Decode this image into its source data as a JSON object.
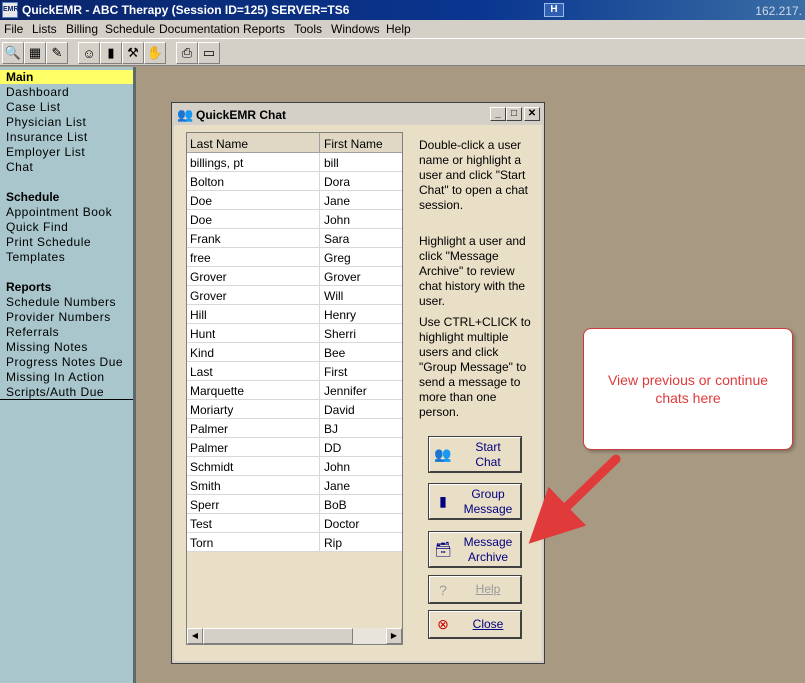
{
  "window": {
    "icon_text": "EMR",
    "title": "QuickEMR - ABC Therapy (Session ID=125) SERVER=TS6",
    "control_glyph": "H",
    "ip_text": "162.217."
  },
  "menu": [
    {
      "label": "File"
    },
    {
      "label": "Lists"
    },
    {
      "label": "Billing"
    },
    {
      "label": "Schedule"
    },
    {
      "label": "Documentation"
    },
    {
      "label": "Reports"
    },
    {
      "label": "Tools"
    },
    {
      "label": "Windows"
    },
    {
      "label": "Help"
    }
  ],
  "toolbar": [
    {
      "icon": "find-icon",
      "glyph": "🔍"
    },
    {
      "icon": "calendar-icon",
      "glyph": "▦"
    },
    {
      "icon": "billing-icon",
      "glyph": "✎"
    },
    {
      "icon": "user-icon",
      "glyph": "☺"
    },
    {
      "icon": "chart-icon",
      "glyph": "▮"
    },
    {
      "icon": "tools-icon",
      "glyph": "⚒"
    },
    {
      "icon": "handshake-icon",
      "glyph": "✋"
    },
    {
      "icon": "export-icon",
      "glyph": "⎙"
    },
    {
      "icon": "print-icon",
      "glyph": "▭"
    }
  ],
  "sidebar": {
    "main": {
      "heading": "Main",
      "items": [
        "Dashboard",
        "Case List",
        "Physician List",
        "Insurance List",
        "Employer List",
        "Chat"
      ]
    },
    "schedule": {
      "heading": "Schedule",
      "items": [
        "Appointment Book",
        "Quick Find",
        "Print Schedule",
        "Templates"
      ]
    },
    "reports": {
      "heading": "Reports",
      "items": [
        "Schedule Numbers",
        "Provider Numbers",
        "Referrals",
        "Missing Notes",
        "Progress Notes Due",
        "Missing In Action",
        "Scripts/Auth Due"
      ]
    }
  },
  "chat": {
    "title": "QuickEMR Chat",
    "columns": {
      "last": "Last Name",
      "first": "First Name"
    },
    "users": [
      {
        "last": "billings, pt",
        "first": "bill"
      },
      {
        "last": "Bolton",
        "first": "Dora"
      },
      {
        "last": "Doe",
        "first": "Jane"
      },
      {
        "last": "Doe",
        "first": "John"
      },
      {
        "last": "Frank",
        "first": "Sara"
      },
      {
        "last": "free",
        "first": "Greg"
      },
      {
        "last": "Grover",
        "first": "Grover"
      },
      {
        "last": "Grover",
        "first": "Will"
      },
      {
        "last": "Hill",
        "first": "Henry"
      },
      {
        "last": "Hunt",
        "first": "Sherri"
      },
      {
        "last": "Kind",
        "first": "Bee"
      },
      {
        "last": "Last",
        "first": "First"
      },
      {
        "last": "Marquette",
        "first": "Jennifer"
      },
      {
        "last": "Moriarty",
        "first": "David"
      },
      {
        "last": "Palmer",
        "first": "BJ"
      },
      {
        "last": "Palmer",
        "first": "DD"
      },
      {
        "last": "Schmidt",
        "first": "John"
      },
      {
        "last": "Smith",
        "first": "Jane"
      },
      {
        "last": "Sperr",
        "first": "BoB"
      },
      {
        "last": "Test",
        "first": "Doctor"
      },
      {
        "last": "Torn",
        "first": "Rip"
      }
    ],
    "help": [
      "Double-click a user name or highlight a user and click \"Start Chat\" to open a chat session.",
      "Highlight a user and click \"Message Archive\" to review chat history with the user.",
      "Use CTRL+CLICK to highlight multiple users and click \"Group Message\" to send a message to more than one person."
    ],
    "buttons": {
      "start": {
        "line1": "Start",
        "line2": "Chat"
      },
      "group": {
        "line1": "Group",
        "line2": "Message"
      },
      "archive": {
        "line1": "Message",
        "line2": "Archive"
      },
      "help": "Help",
      "close": "Close"
    }
  },
  "callout": {
    "text": "View previous or continue chats here",
    "color": "#e03a3a"
  }
}
